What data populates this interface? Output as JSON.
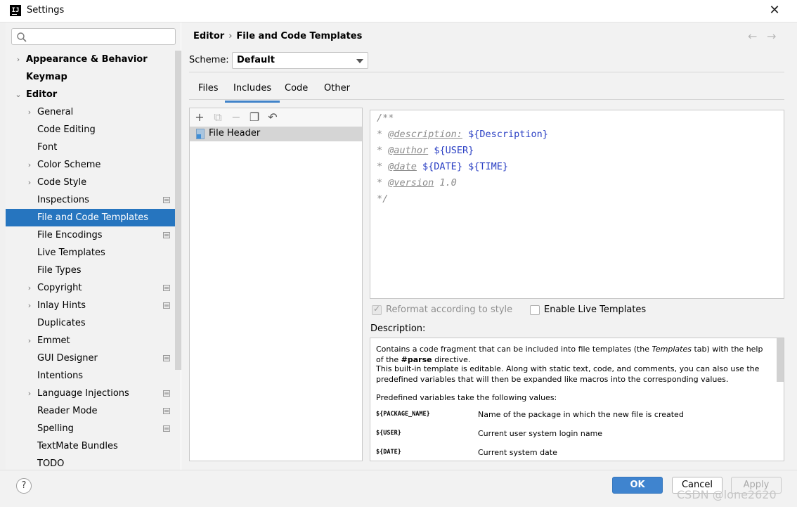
{
  "window": {
    "title": "Settings",
    "icon_text": "IJ",
    "close": "✕"
  },
  "search": {
    "placeholder": ""
  },
  "breadcrumb": {
    "parent": "Editor",
    "separator": "›",
    "current": "File and Code Templates"
  },
  "nav": {
    "back": "←",
    "forward": "→"
  },
  "scheme": {
    "label": "Scheme:",
    "value": "Default"
  },
  "tabs": [
    {
      "label": "Files",
      "active": false
    },
    {
      "label": "Includes",
      "active": true
    },
    {
      "label": "Code",
      "active": false
    },
    {
      "label": "Other",
      "active": false
    }
  ],
  "sidebar": {
    "items": [
      {
        "label": "Appearance & Behavior",
        "level": 0,
        "arrow": "›",
        "bold": true
      },
      {
        "label": "Keymap",
        "level": 0,
        "arrow": "",
        "bold": true
      },
      {
        "label": "Editor",
        "level": 0,
        "arrow": "⌄",
        "bold": true
      },
      {
        "label": "General",
        "level": 1,
        "arrow": "›"
      },
      {
        "label": "Code Editing",
        "level": 1,
        "arrow": ""
      },
      {
        "label": "Font",
        "level": 1,
        "arrow": ""
      },
      {
        "label": "Color Scheme",
        "level": 1,
        "arrow": "›"
      },
      {
        "label": "Code Style",
        "level": 1,
        "arrow": "›"
      },
      {
        "label": "Inspections",
        "level": 1,
        "arrow": "",
        "project": true
      },
      {
        "label": "File and Code Templates",
        "level": 1,
        "arrow": "",
        "selected": true
      },
      {
        "label": "File Encodings",
        "level": 1,
        "arrow": "",
        "project": true
      },
      {
        "label": "Live Templates",
        "level": 1,
        "arrow": ""
      },
      {
        "label": "File Types",
        "level": 1,
        "arrow": ""
      },
      {
        "label": "Copyright",
        "level": 1,
        "arrow": "›",
        "project": true
      },
      {
        "label": "Inlay Hints",
        "level": 1,
        "arrow": "›",
        "project": true
      },
      {
        "label": "Duplicates",
        "level": 1,
        "arrow": ""
      },
      {
        "label": "Emmet",
        "level": 1,
        "arrow": "›"
      },
      {
        "label": "GUI Designer",
        "level": 1,
        "arrow": "",
        "project": true
      },
      {
        "label": "Intentions",
        "level": 1,
        "arrow": ""
      },
      {
        "label": "Language Injections",
        "level": 1,
        "arrow": "›",
        "project": true
      },
      {
        "label": "Reader Mode",
        "level": 1,
        "arrow": "",
        "project": true
      },
      {
        "label": "Spelling",
        "level": 1,
        "arrow": "",
        "project": true
      },
      {
        "label": "TextMate Bundles",
        "level": 1,
        "arrow": ""
      },
      {
        "label": "TODO",
        "level": 1,
        "arrow": ""
      }
    ]
  },
  "toolbar": {
    "add": "+",
    "copy_add": "⧉",
    "remove": "−",
    "copy": "❐",
    "reset": "↶"
  },
  "template_list": {
    "items": [
      "File Header"
    ]
  },
  "editor": {
    "lines": [
      [
        {
          "t": "/**",
          "c": "comment"
        }
      ],
      [
        {
          "t": "* ",
          "c": "comment"
        },
        {
          "t": "@description:",
          "c": "tag"
        },
        {
          "t": " ",
          "c": "comment"
        },
        {
          "t": "${Description}",
          "c": "var"
        }
      ],
      [
        {
          "t": "* ",
          "c": "comment"
        },
        {
          "t": "@author",
          "c": "tag"
        },
        {
          "t": " ",
          "c": "comment"
        },
        {
          "t": "${USER}",
          "c": "var"
        }
      ],
      [
        {
          "t": "* ",
          "c": "comment"
        },
        {
          "t": "@date",
          "c": "tag"
        },
        {
          "t": " ",
          "c": "comment"
        },
        {
          "t": "${DATE}",
          "c": "var"
        },
        {
          "t": " ",
          "c": "comment"
        },
        {
          "t": "${TIME}",
          "c": "var"
        }
      ],
      [
        {
          "t": "* ",
          "c": "comment"
        },
        {
          "t": "@version",
          "c": "tag"
        },
        {
          "t": " 1.0",
          "c": "comment"
        }
      ],
      [
        {
          "t": "*/",
          "c": "comment"
        }
      ]
    ]
  },
  "options": {
    "reformat": {
      "label": "Reformat according to style",
      "checked": true,
      "disabled": true
    },
    "live_templates": {
      "label": "Enable Live Templates",
      "checked": false
    }
  },
  "description": {
    "label": "Description:",
    "p1_a": "Contains a code fragment that can be included into file templates (the ",
    "p1_em": "Templates",
    "p1_b": " tab) with the help of the ",
    "p1_strong": "#parse",
    "p1_c": " directive.",
    "p2": "This built-in template is editable. Along with static text, code, and comments, you can also use the predefined variables that will then be expanded like macros into the corresponding values.",
    "p3": "Predefined variables take the following values:",
    "vars": [
      {
        "name": "${PACKAGE_NAME}",
        "desc": "Name of the package in which the new file is created"
      },
      {
        "name": "${USER}",
        "desc": "Current user system login name"
      },
      {
        "name": "${DATE}",
        "desc": "Current system date"
      }
    ]
  },
  "buttons": {
    "help": "?",
    "ok": "OK",
    "cancel": "Cancel",
    "apply": "Apply"
  },
  "watermark": "CSDN @lone2620",
  "colors": {
    "selection": "#2675bf",
    "ok_button": "#3f84cf",
    "template_var": "#2b40c4"
  }
}
